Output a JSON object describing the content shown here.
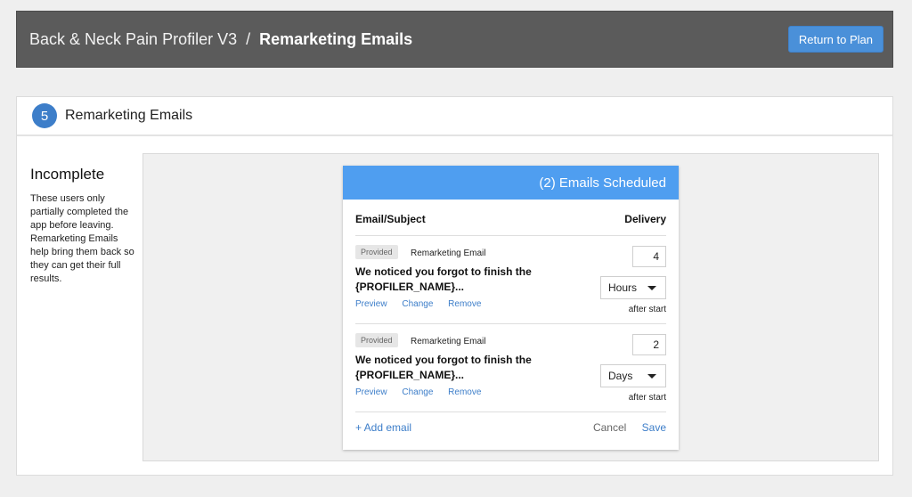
{
  "header": {
    "project": "Back & Neck Pain Profiler V3",
    "separator": "/",
    "current": "Remarketing Emails",
    "return_button": "Return to Plan"
  },
  "section": {
    "step": "5",
    "title": "Remarketing Emails"
  },
  "sidebar": {
    "heading": "Incomplete",
    "description": "These users only partially completed the app before leaving. Remarketing Emails help bring them back so they can get their full results."
  },
  "card": {
    "title": "(2) Emails Scheduled",
    "col_subject": "Email/Subject",
    "col_delivery": "Delivery",
    "emails": [
      {
        "badge": "Provided",
        "name": "Remarketing Email",
        "subject": "We noticed you forgot to finish the {PROFILER_NAME}...",
        "preview": "Preview",
        "change": "Change",
        "remove": "Remove",
        "amount": "4",
        "unit": "Hours",
        "after": "after start"
      },
      {
        "badge": "Provided",
        "name": "Remarketing Email",
        "subject": "We noticed you forgot to finish the {PROFILER_NAME}...",
        "preview": "Preview",
        "change": "Change",
        "remove": "Remove",
        "amount": "2",
        "unit": "Days",
        "after": "after start"
      }
    ],
    "add_email": "+ Add email",
    "cancel": "Cancel",
    "save": "Save"
  },
  "colors": {
    "topbar": "#5b5b5b",
    "accent": "#4a90d9",
    "card_header": "#4f9ef0",
    "link": "#3d7ec9"
  }
}
